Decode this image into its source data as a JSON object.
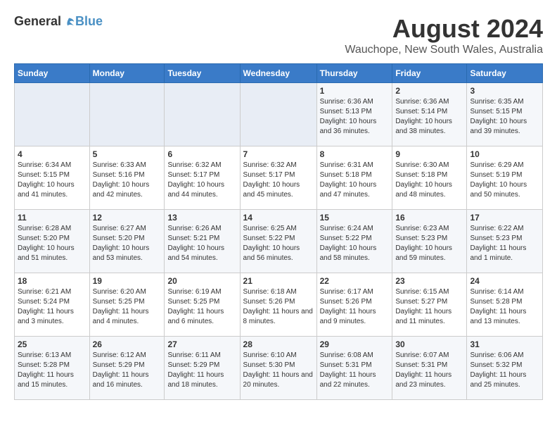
{
  "header": {
    "logo_general": "General",
    "logo_blue": "Blue",
    "title": "August 2024",
    "subtitle": "Wauchope, New South Wales, Australia"
  },
  "calendar": {
    "days_of_week": [
      "Sunday",
      "Monday",
      "Tuesday",
      "Wednesday",
      "Thursday",
      "Friday",
      "Saturday"
    ],
    "weeks": [
      [
        {
          "day": "",
          "content": ""
        },
        {
          "day": "",
          "content": ""
        },
        {
          "day": "",
          "content": ""
        },
        {
          "day": "",
          "content": ""
        },
        {
          "day": "1",
          "content": "Sunrise: 6:36 AM\nSunset: 5:13 PM\nDaylight: 10 hours and 36 minutes."
        },
        {
          "day": "2",
          "content": "Sunrise: 6:36 AM\nSunset: 5:14 PM\nDaylight: 10 hours and 38 minutes."
        },
        {
          "day": "3",
          "content": "Sunrise: 6:35 AM\nSunset: 5:15 PM\nDaylight: 10 hours and 39 minutes."
        }
      ],
      [
        {
          "day": "4",
          "content": "Sunrise: 6:34 AM\nSunset: 5:15 PM\nDaylight: 10 hours and 41 minutes."
        },
        {
          "day": "5",
          "content": "Sunrise: 6:33 AM\nSunset: 5:16 PM\nDaylight: 10 hours and 42 minutes."
        },
        {
          "day": "6",
          "content": "Sunrise: 6:32 AM\nSunset: 5:17 PM\nDaylight: 10 hours and 44 minutes."
        },
        {
          "day": "7",
          "content": "Sunrise: 6:32 AM\nSunset: 5:17 PM\nDaylight: 10 hours and 45 minutes."
        },
        {
          "day": "8",
          "content": "Sunrise: 6:31 AM\nSunset: 5:18 PM\nDaylight: 10 hours and 47 minutes."
        },
        {
          "day": "9",
          "content": "Sunrise: 6:30 AM\nSunset: 5:18 PM\nDaylight: 10 hours and 48 minutes."
        },
        {
          "day": "10",
          "content": "Sunrise: 6:29 AM\nSunset: 5:19 PM\nDaylight: 10 hours and 50 minutes."
        }
      ],
      [
        {
          "day": "11",
          "content": "Sunrise: 6:28 AM\nSunset: 5:20 PM\nDaylight: 10 hours and 51 minutes."
        },
        {
          "day": "12",
          "content": "Sunrise: 6:27 AM\nSunset: 5:20 PM\nDaylight: 10 hours and 53 minutes."
        },
        {
          "day": "13",
          "content": "Sunrise: 6:26 AM\nSunset: 5:21 PM\nDaylight: 10 hours and 54 minutes."
        },
        {
          "day": "14",
          "content": "Sunrise: 6:25 AM\nSunset: 5:22 PM\nDaylight: 10 hours and 56 minutes."
        },
        {
          "day": "15",
          "content": "Sunrise: 6:24 AM\nSunset: 5:22 PM\nDaylight: 10 hours and 58 minutes."
        },
        {
          "day": "16",
          "content": "Sunrise: 6:23 AM\nSunset: 5:23 PM\nDaylight: 10 hours and 59 minutes."
        },
        {
          "day": "17",
          "content": "Sunrise: 6:22 AM\nSunset: 5:23 PM\nDaylight: 11 hours and 1 minute."
        }
      ],
      [
        {
          "day": "18",
          "content": "Sunrise: 6:21 AM\nSunset: 5:24 PM\nDaylight: 11 hours and 3 minutes."
        },
        {
          "day": "19",
          "content": "Sunrise: 6:20 AM\nSunset: 5:25 PM\nDaylight: 11 hours and 4 minutes."
        },
        {
          "day": "20",
          "content": "Sunrise: 6:19 AM\nSunset: 5:25 PM\nDaylight: 11 hours and 6 minutes."
        },
        {
          "day": "21",
          "content": "Sunrise: 6:18 AM\nSunset: 5:26 PM\nDaylight: 11 hours and 8 minutes."
        },
        {
          "day": "22",
          "content": "Sunrise: 6:17 AM\nSunset: 5:26 PM\nDaylight: 11 hours and 9 minutes."
        },
        {
          "day": "23",
          "content": "Sunrise: 6:15 AM\nSunset: 5:27 PM\nDaylight: 11 hours and 11 minutes."
        },
        {
          "day": "24",
          "content": "Sunrise: 6:14 AM\nSunset: 5:28 PM\nDaylight: 11 hours and 13 minutes."
        }
      ],
      [
        {
          "day": "25",
          "content": "Sunrise: 6:13 AM\nSunset: 5:28 PM\nDaylight: 11 hours and 15 minutes."
        },
        {
          "day": "26",
          "content": "Sunrise: 6:12 AM\nSunset: 5:29 PM\nDaylight: 11 hours and 16 minutes."
        },
        {
          "day": "27",
          "content": "Sunrise: 6:11 AM\nSunset: 5:29 PM\nDaylight: 11 hours and 18 minutes."
        },
        {
          "day": "28",
          "content": "Sunrise: 6:10 AM\nSunset: 5:30 PM\nDaylight: 11 hours and 20 minutes."
        },
        {
          "day": "29",
          "content": "Sunrise: 6:08 AM\nSunset: 5:31 PM\nDaylight: 11 hours and 22 minutes."
        },
        {
          "day": "30",
          "content": "Sunrise: 6:07 AM\nSunset: 5:31 PM\nDaylight: 11 hours and 23 minutes."
        },
        {
          "day": "31",
          "content": "Sunrise: 6:06 AM\nSunset: 5:32 PM\nDaylight: 11 hours and 25 minutes."
        }
      ]
    ]
  }
}
